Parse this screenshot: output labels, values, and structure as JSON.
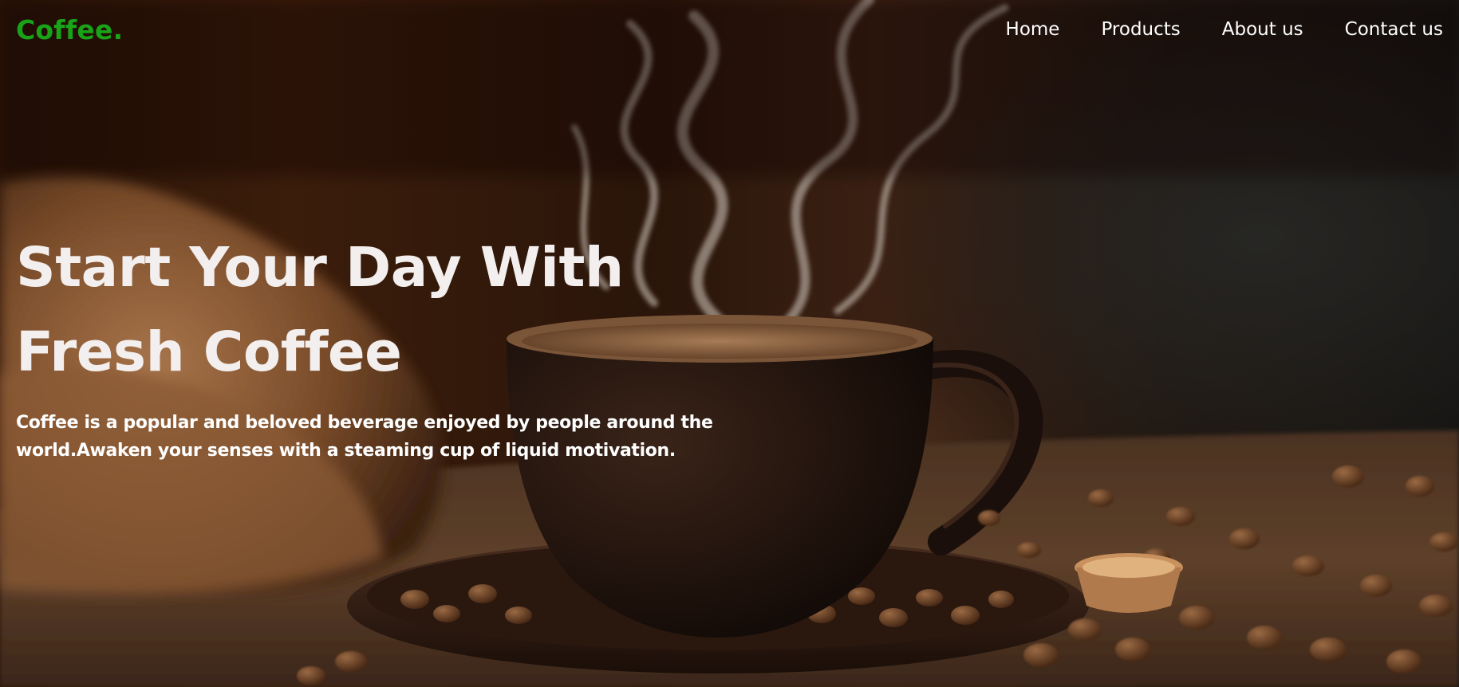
{
  "nav": {
    "logo": "Coffee.",
    "links": [
      {
        "label": "Home"
      },
      {
        "label": "Products"
      },
      {
        "label": "About us"
      },
      {
        "label": "Contact us"
      }
    ]
  },
  "hero": {
    "headline_line1": "Start Your Day With",
    "headline_line2": "Fresh Coffee",
    "description": "Coffee is a popular and beloved beverage enjoyed by people around the world.Awaken your senses with a steaming cup of liquid motivation.",
    "background_image": "coffee cup with steam on saucer of coffee beans, burlap sack, scattered beans on wooden table"
  },
  "colors": {
    "logo": "#19a318",
    "nav_text": "#ffffff",
    "headline": "#f3efee",
    "description": "#ffffff"
  }
}
